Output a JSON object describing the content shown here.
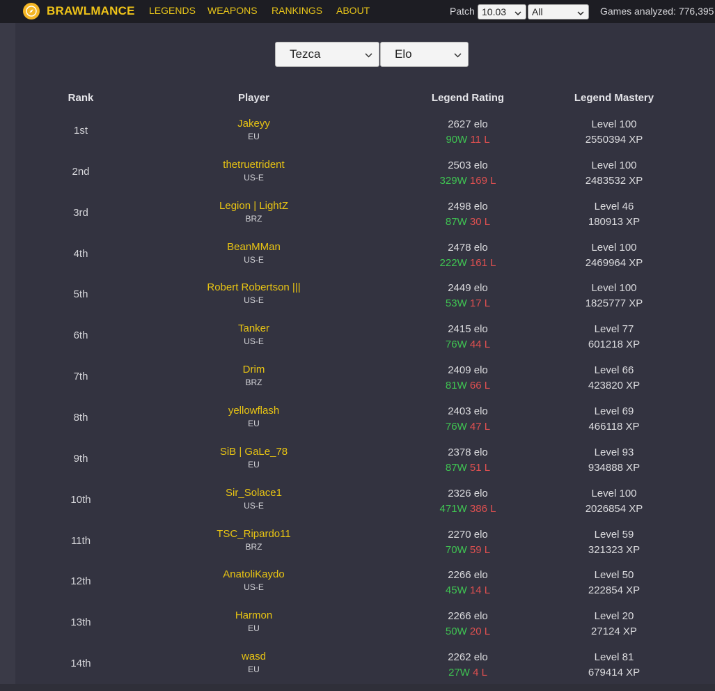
{
  "nav": {
    "brand": "BRAWLMANCE",
    "items": [
      "LEGENDS",
      "WEAPONS",
      "RANKINGS",
      "ABOUT"
    ],
    "patch_label": "Patch",
    "patch_value": "10.03",
    "mode_value": "All",
    "games_analyzed": "Games analyzed: 776,395"
  },
  "filters": {
    "legend": "Tezca",
    "sort": "Elo"
  },
  "table": {
    "headers": [
      "Rank",
      "Player",
      "Legend Rating",
      "Legend Mastery"
    ],
    "rows": [
      {
        "rank": "1st",
        "player": "Jakeyy",
        "region": "EU",
        "elo": "2627 elo",
        "wins": "90W",
        "losses": "11 L",
        "level": "Level 100",
        "xp": "2550394 XP"
      },
      {
        "rank": "2nd",
        "player": "thetruetrident",
        "region": "US-E",
        "elo": "2503 elo",
        "wins": "329W",
        "losses": "169 L",
        "level": "Level 100",
        "xp": "2483532 XP"
      },
      {
        "rank": "3rd",
        "player": "Legion | LightZ",
        "region": "BRZ",
        "elo": "2498 elo",
        "wins": "87W",
        "losses": "30 L",
        "level": "Level 46",
        "xp": "180913 XP"
      },
      {
        "rank": "4th",
        "player": "BeanMMan",
        "region": "US-E",
        "elo": "2478 elo",
        "wins": "222W",
        "losses": "161 L",
        "level": "Level 100",
        "xp": "2469964 XP"
      },
      {
        "rank": "5th",
        "player": "Robert Robertson |||",
        "region": "US-E",
        "elo": "2449 elo",
        "wins": "53W",
        "losses": "17 L",
        "level": "Level 100",
        "xp": "1825777 XP"
      },
      {
        "rank": "6th",
        "player": "Tanker",
        "region": "US-E",
        "elo": "2415 elo",
        "wins": "76W",
        "losses": "44 L",
        "level": "Level 77",
        "xp": "601218 XP"
      },
      {
        "rank": "7th",
        "player": "Drim",
        "region": "BRZ",
        "elo": "2409 elo",
        "wins": "81W",
        "losses": "66 L",
        "level": "Level 66",
        "xp": "423820 XP"
      },
      {
        "rank": "8th",
        "player": "yellowflash",
        "region": "EU",
        "elo": "2403 elo",
        "wins": "76W",
        "losses": "47 L",
        "level": "Level 69",
        "xp": "466118 XP"
      },
      {
        "rank": "9th",
        "player": "SiB | GaLe_78",
        "region": "EU",
        "elo": "2378 elo",
        "wins": "87W",
        "losses": "51 L",
        "level": "Level 93",
        "xp": "934888 XP"
      },
      {
        "rank": "10th",
        "player": "Sir_Solace1",
        "region": "US-E",
        "elo": "2326 elo",
        "wins": "471W",
        "losses": "386 L",
        "level": "Level 100",
        "xp": "2026854 XP"
      },
      {
        "rank": "11th",
        "player": "TSC_Ripardo11",
        "region": "BRZ",
        "elo": "2270 elo",
        "wins": "70W",
        "losses": "59 L",
        "level": "Level 59",
        "xp": "321323 XP"
      },
      {
        "rank": "12th",
        "player": "AnatoliKaydo",
        "region": "US-E",
        "elo": "2266 elo",
        "wins": "45W",
        "losses": "14 L",
        "level": "Level 50",
        "xp": "222854 XP"
      },
      {
        "rank": "13th",
        "player": "Harmon",
        "region": "EU",
        "elo": "2266 elo",
        "wins": "50W",
        "losses": "20 L",
        "level": "Level 20",
        "xp": "27124 XP"
      },
      {
        "rank": "14th",
        "player": "wasd",
        "region": "EU",
        "elo": "2262 elo",
        "wins": "27W",
        "losses": "4 L",
        "level": "Level 81",
        "xp": "679414 XP"
      }
    ]
  }
}
